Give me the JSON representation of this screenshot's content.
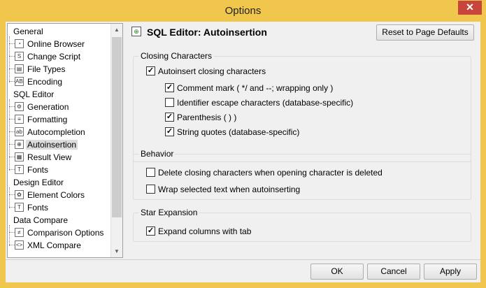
{
  "window": {
    "title": "Options",
    "close_glyph": "✕"
  },
  "tree": {
    "items": [
      {
        "kind": "category",
        "label": "General"
      },
      {
        "kind": "item",
        "label": "Online Browser",
        "icon": "online-browser-icon",
        "glyph": "◔"
      },
      {
        "kind": "item",
        "label": "Change Script",
        "icon": "change-script-icon",
        "glyph": "S"
      },
      {
        "kind": "item",
        "label": "File Types",
        "icon": "file-types-icon",
        "glyph": "▤"
      },
      {
        "kind": "item",
        "label": "Encoding",
        "icon": "encoding-icon",
        "glyph": "AB"
      },
      {
        "kind": "category",
        "label": "SQL Editor"
      },
      {
        "kind": "item",
        "label": "Generation",
        "icon": "generation-icon",
        "glyph": "⚙"
      },
      {
        "kind": "item",
        "label": "Formatting",
        "icon": "formatting-icon",
        "glyph": "≡"
      },
      {
        "kind": "item",
        "label": "Autocompletion",
        "icon": "autocompletion-icon",
        "glyph": "ab"
      },
      {
        "kind": "item",
        "label": "Autoinsertion",
        "icon": "autoinsertion-icon",
        "glyph": "⊕",
        "selected": true
      },
      {
        "kind": "item",
        "label": "Result View",
        "icon": "result-view-icon",
        "glyph": "▦"
      },
      {
        "kind": "item",
        "label": "Fonts",
        "icon": "fonts-icon",
        "glyph": "T"
      },
      {
        "kind": "category",
        "label": "Design Editor"
      },
      {
        "kind": "item",
        "label": "Element Colors",
        "icon": "element-colors-icon",
        "glyph": "✿"
      },
      {
        "kind": "item",
        "label": "Fonts",
        "icon": "fonts-icon",
        "glyph": "T"
      },
      {
        "kind": "category",
        "label": "Data Compare"
      },
      {
        "kind": "item",
        "label": "Comparison Options",
        "icon": "comparison-options-icon",
        "glyph": "≠"
      },
      {
        "kind": "item",
        "label": "XML Compare",
        "icon": "xml-compare-icon",
        "glyph": "<>"
      }
    ]
  },
  "pane": {
    "heading": "SQL Editor: Autoinsertion",
    "heading_icon": "autoinsertion-icon",
    "reset_label": "Reset to Page Defaults",
    "groups": {
      "closing": {
        "title": "Closing Characters",
        "options": [
          {
            "label": "Autoinsert closing characters",
            "checked": true
          },
          {
            "label": "Comment mark ( */ and --; wrapping only )",
            "checked": true
          },
          {
            "label": "Identifier escape characters (database-specific)",
            "checked": false
          },
          {
            "label": "Parenthesis ( ) )",
            "checked": true
          },
          {
            "label": "String quotes (database-specific)",
            "checked": true
          }
        ]
      },
      "behavior": {
        "title": "Behavior",
        "options": [
          {
            "label": "Delete closing characters when opening character is deleted",
            "checked": false
          },
          {
            "label": "Wrap selected text when autoinserting",
            "checked": false
          }
        ]
      },
      "star": {
        "title": "Star Expansion",
        "options": [
          {
            "label": "Expand columns with tab",
            "checked": true
          }
        ]
      }
    }
  },
  "footer": {
    "ok_label": "OK",
    "cancel_label": "Cancel",
    "apply_label": "Apply"
  },
  "check_glyph": "✓",
  "scroll": {
    "up_glyph": "▲",
    "down_glyph": "▼"
  }
}
